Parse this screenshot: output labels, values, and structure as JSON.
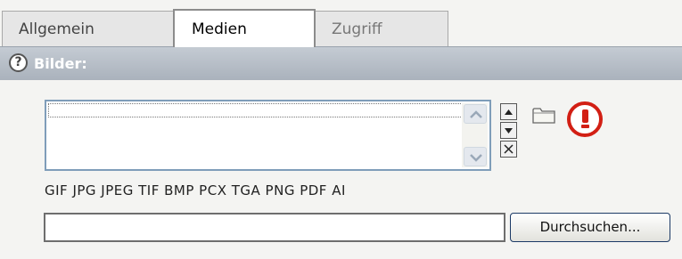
{
  "tabs": [
    {
      "label": "Allgemein",
      "active": false
    },
    {
      "label": "Medien",
      "active": true
    },
    {
      "label": "Zugriff",
      "active": false
    }
  ],
  "section": {
    "help_icon": "question-icon",
    "help_glyph": "?",
    "title": "Bilder:"
  },
  "list": {
    "items": [],
    "selected_index": 0
  },
  "icons": {
    "move_up": "arrow-up-icon",
    "move_down": "arrow-down-icon",
    "remove": "delete-x-icon",
    "browse_folder": "folder-icon",
    "warning": "warning-exclamation-icon"
  },
  "allowed_types": "GIF JPG JPEG TIF BMP PCX TGA PNG PDF AI",
  "file_input": {
    "value": "",
    "browse_label": "Durchsuchen..."
  },
  "colors": {
    "header_bg": "#aab2bc",
    "warning": "#d21f14",
    "list_border": "#7f9db9"
  }
}
